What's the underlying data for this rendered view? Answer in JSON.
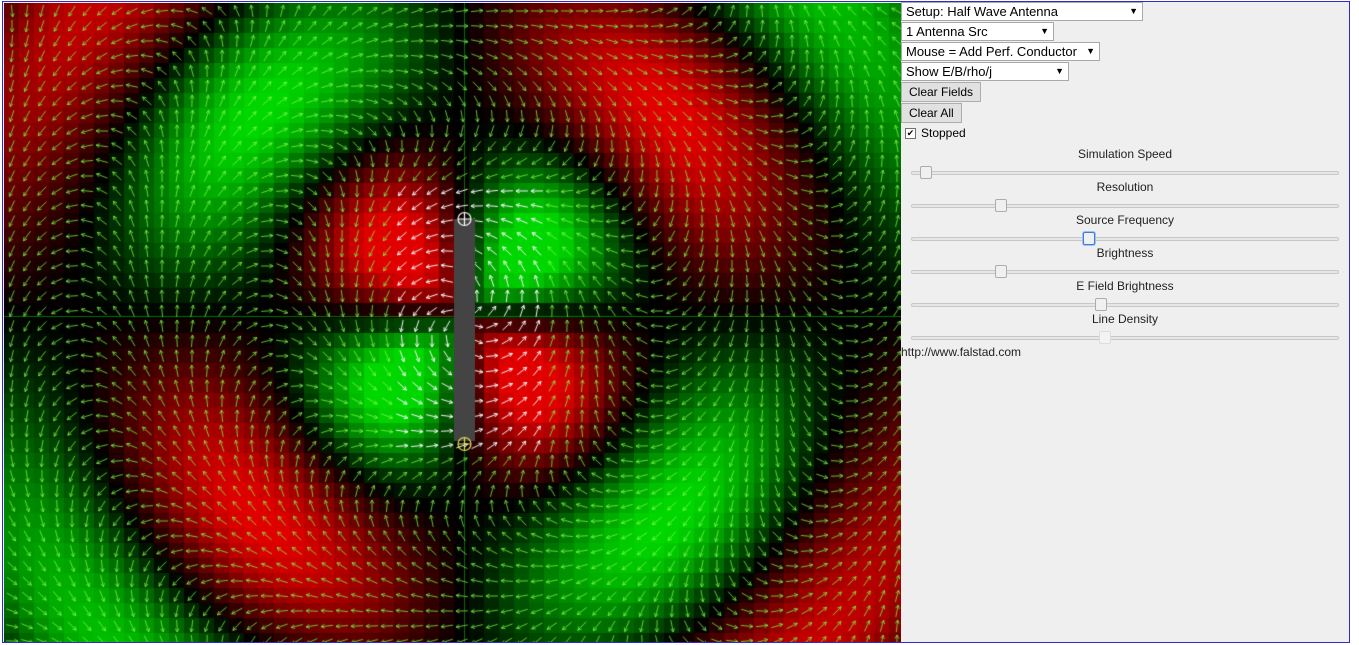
{
  "controls": {
    "setup_select": "Setup: Half Wave Antenna",
    "source_select": "1 Antenna Src",
    "mouse_select": "Mouse = Add Perf. Conductor",
    "show_select": "Show E/B/rho/j",
    "clear_fields": "Clear Fields",
    "clear_all": "Clear All",
    "stopped_label": "Stopped",
    "stopped_checked": true
  },
  "sliders": [
    {
      "label": "Simulation Speed",
      "value": 0.02
    },
    {
      "label": "Resolution",
      "value": 0.2
    },
    {
      "label": "Source Frequency",
      "value": 0.41
    },
    {
      "label": "Brightness",
      "value": 0.2
    },
    {
      "label": "E Field Brightness",
      "value": 0.44
    },
    {
      "label": "Line Density",
      "value": 0.45
    }
  ],
  "footer": {
    "link_text": "http://www.falstad.com"
  },
  "colors": {
    "field_positive": "#e00000",
    "field_negative": "#00d000",
    "arrow_color": "#7dff4a",
    "arrow_near_color": "#ffffff",
    "conductor": "#444444",
    "feed_marker": "#e8e05a"
  }
}
